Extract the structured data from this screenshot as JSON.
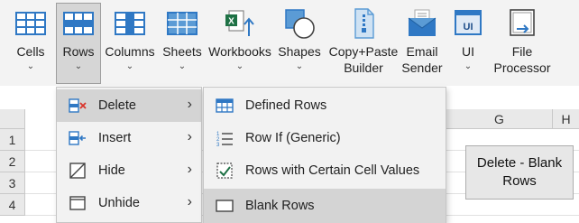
{
  "ribbon": {
    "buttons": [
      {
        "label": "Cells",
        "chevron": "⌄",
        "icon": "table-grid-icon"
      },
      {
        "label": "Rows",
        "chevron": "⌄",
        "icon": "rows-table-icon",
        "active": true
      },
      {
        "label": "Columns",
        "chevron": "⌄",
        "icon": "columns-table-icon"
      },
      {
        "label": "Sheets",
        "chevron": "⌄",
        "icon": "sheets-grid-icon"
      },
      {
        "label": "Workbooks",
        "chevron": "⌄",
        "icon": "excel-workbook-icon"
      },
      {
        "label": "Shapes",
        "chevron": "⌄",
        "icon": "shapes-icon"
      },
      {
        "label": "Copy+Paste\nBuilder",
        "icon": "document-zip-icon"
      },
      {
        "label": "Email\nSender",
        "icon": "envelope-icon"
      },
      {
        "label": "UI",
        "chevron": "⌄",
        "icon": "ui-window-icon"
      },
      {
        "label": "File\nProcessor",
        "icon": "file-processor-icon"
      }
    ]
  },
  "sheet": {
    "columns": [
      "G",
      "H"
    ],
    "rows": [
      "1",
      "2",
      "3",
      "4"
    ],
    "button_label": "Delete - Blank\nRows"
  },
  "menu": {
    "items": [
      {
        "label": "Delete",
        "icon": "delete-rows-icon",
        "submenu_arrow": "›",
        "selected": true
      },
      {
        "label": "Insert",
        "icon": "insert-rows-icon",
        "submenu_arrow": "›"
      },
      {
        "label": "Hide",
        "icon": "hide-icon",
        "submenu_arrow": "›"
      },
      {
        "label": "Unhide",
        "icon": "unhide-icon",
        "submenu_arrow": "›"
      }
    ]
  },
  "submenu": {
    "items": [
      {
        "label": "Defined Rows",
        "icon": "defined-rows-icon"
      },
      {
        "label": "Row If (Generic)",
        "icon": "numbered-list-icon"
      },
      {
        "label": "Rows with Certain Cell Values",
        "icon": "checked-cell-icon"
      },
      {
        "label": "Blank Rows",
        "icon": "blank-row-icon",
        "selected": true
      }
    ]
  },
  "colors": {
    "ribbon_bg": "#f3f3f3",
    "accent_blue": "#2f78c4",
    "excel_green": "#1e7145",
    "menu_bg": "#f2f2f2",
    "menu_selected": "#d4d4d4"
  }
}
